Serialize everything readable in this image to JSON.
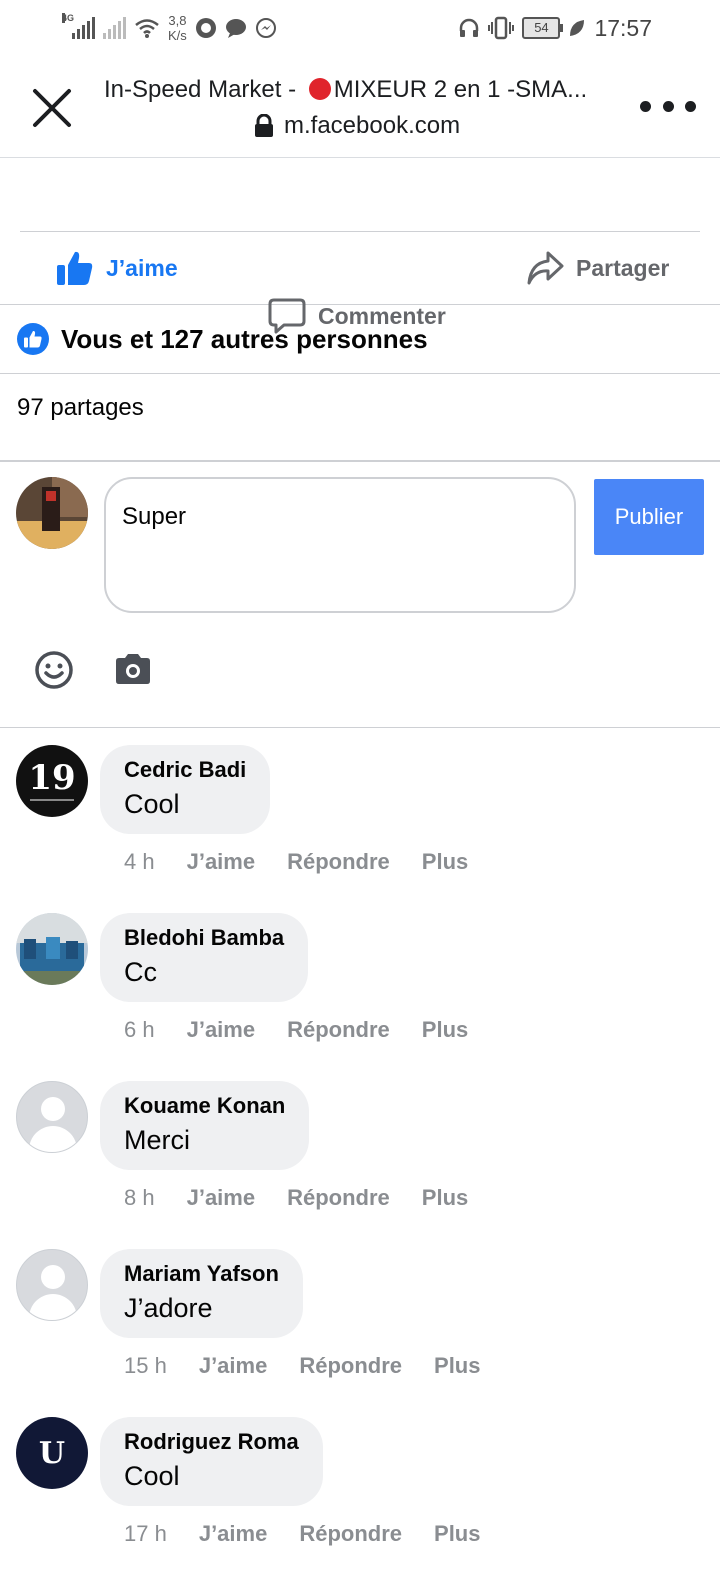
{
  "status_bar": {
    "network": "4G",
    "speed_value": "3,8",
    "speed_unit": "K/s",
    "battery": "54",
    "time": "17:57"
  },
  "header": {
    "title_prefix": "In-Speed Market - ",
    "title_suffix": "MIXEUR 2 en 1 -SMA...",
    "url": "m.facebook.com"
  },
  "actions": {
    "like": "J’aime",
    "comment": "Commenter",
    "share": "Partager"
  },
  "reactions_text": "Vous et 127 autres personnes",
  "shares_text": "97 partages",
  "composer": {
    "value": "Super",
    "publish_label": "Publier"
  },
  "comment_actions": {
    "like": "J’aime",
    "reply": "Répondre",
    "more": "Plus"
  },
  "comments": [
    {
      "author": "Cedric Badi",
      "text": "Cool",
      "time": "4 h",
      "avatar_label": "19"
    },
    {
      "author": "Bledohi Bamba",
      "text": "Cc",
      "time": "6 h"
    },
    {
      "author": "Kouame Konan",
      "text": "Merci",
      "time": "8 h"
    },
    {
      "author": "Mariam Yafson",
      "text": "J’adore",
      "time": "15 h"
    },
    {
      "author": "Rodriguez Roma",
      "text": "Cool",
      "time": "17 h",
      "avatar_label": "U"
    }
  ],
  "colors": {
    "facebook_blue": "#1877f2",
    "publish_button": "#4a86f7",
    "bubble": "#eff0f2",
    "meta_gray": "#8a8d91"
  }
}
